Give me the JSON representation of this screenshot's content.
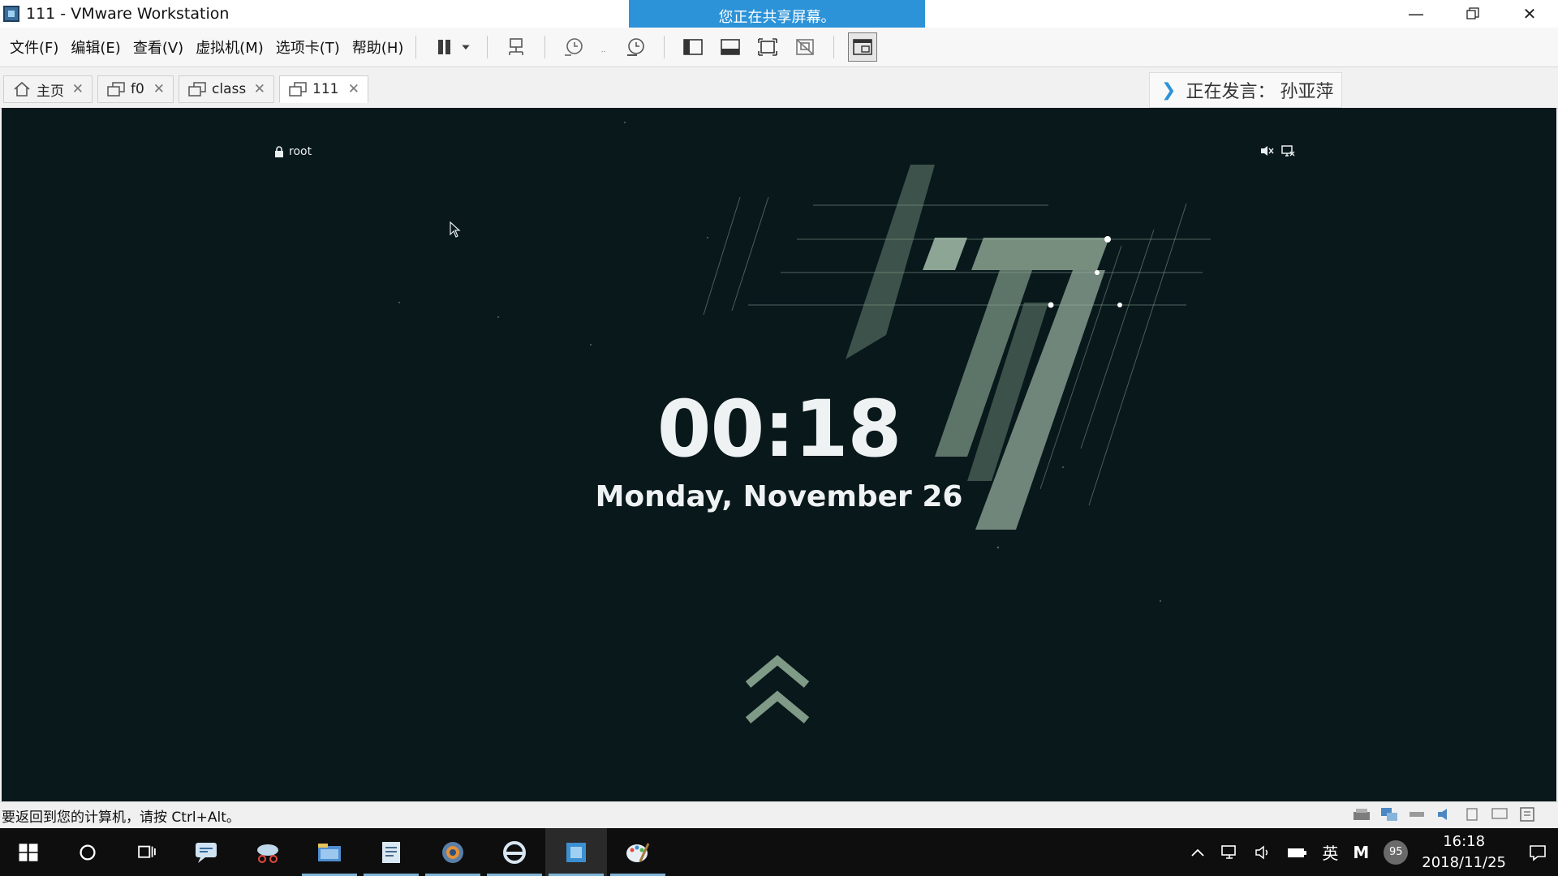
{
  "window": {
    "title": "111 - VMware Workstation"
  },
  "share_banner": "您正在共享屏幕。",
  "menu": [
    "文件(F)",
    "编辑(E)",
    "查看(V)",
    "虚拟机(M)",
    "选项卡(T)",
    "帮助(H)"
  ],
  "tabs": [
    {
      "label": "主页",
      "icon": "home-icon"
    },
    {
      "label": "f0",
      "icon": "vm-icon"
    },
    {
      "label": "class",
      "icon": "vm-icon"
    },
    {
      "label": "111",
      "icon": "vm-icon",
      "active": true
    }
  ],
  "speaker": {
    "label": "正在发言：",
    "name": "孙亚萍"
  },
  "vm": {
    "user": "root",
    "time": "00:18",
    "date": "Monday, November 26"
  },
  "status": {
    "text": "要返回到您的计算机，请按 Ctrl+Alt。"
  },
  "taskbar": {
    "ime": "英",
    "ime2": "M",
    "badge": "95",
    "time": "16:18",
    "date": "2018/11/25"
  },
  "colors": {
    "accent": "#2c93d8",
    "vm_bg": "#08181b",
    "stripe": "#9fb8a4"
  }
}
